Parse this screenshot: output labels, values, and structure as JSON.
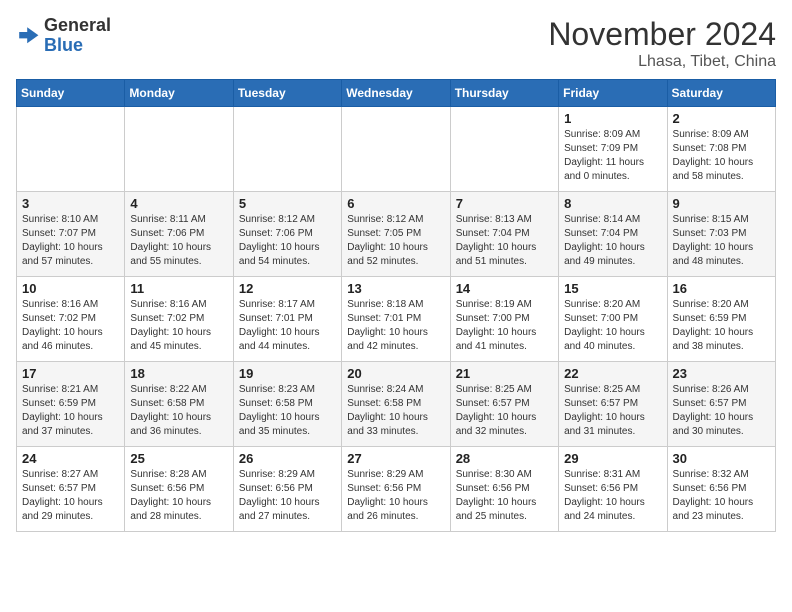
{
  "header": {
    "logo_general": "General",
    "logo_blue": "Blue",
    "month_title": "November 2024",
    "location": "Lhasa, Tibet, China"
  },
  "days_of_week": [
    "Sunday",
    "Monday",
    "Tuesday",
    "Wednesday",
    "Thursday",
    "Friday",
    "Saturday"
  ],
  "weeks": [
    [
      {
        "day": "",
        "info": ""
      },
      {
        "day": "",
        "info": ""
      },
      {
        "day": "",
        "info": ""
      },
      {
        "day": "",
        "info": ""
      },
      {
        "day": "",
        "info": ""
      },
      {
        "day": "1",
        "info": "Sunrise: 8:09 AM\nSunset: 7:09 PM\nDaylight: 11 hours\nand 0 minutes."
      },
      {
        "day": "2",
        "info": "Sunrise: 8:09 AM\nSunset: 7:08 PM\nDaylight: 10 hours\nand 58 minutes."
      }
    ],
    [
      {
        "day": "3",
        "info": "Sunrise: 8:10 AM\nSunset: 7:07 PM\nDaylight: 10 hours\nand 57 minutes."
      },
      {
        "day": "4",
        "info": "Sunrise: 8:11 AM\nSunset: 7:06 PM\nDaylight: 10 hours\nand 55 minutes."
      },
      {
        "day": "5",
        "info": "Sunrise: 8:12 AM\nSunset: 7:06 PM\nDaylight: 10 hours\nand 54 minutes."
      },
      {
        "day": "6",
        "info": "Sunrise: 8:12 AM\nSunset: 7:05 PM\nDaylight: 10 hours\nand 52 minutes."
      },
      {
        "day": "7",
        "info": "Sunrise: 8:13 AM\nSunset: 7:04 PM\nDaylight: 10 hours\nand 51 minutes."
      },
      {
        "day": "8",
        "info": "Sunrise: 8:14 AM\nSunset: 7:04 PM\nDaylight: 10 hours\nand 49 minutes."
      },
      {
        "day": "9",
        "info": "Sunrise: 8:15 AM\nSunset: 7:03 PM\nDaylight: 10 hours\nand 48 minutes."
      }
    ],
    [
      {
        "day": "10",
        "info": "Sunrise: 8:16 AM\nSunset: 7:02 PM\nDaylight: 10 hours\nand 46 minutes."
      },
      {
        "day": "11",
        "info": "Sunrise: 8:16 AM\nSunset: 7:02 PM\nDaylight: 10 hours\nand 45 minutes."
      },
      {
        "day": "12",
        "info": "Sunrise: 8:17 AM\nSunset: 7:01 PM\nDaylight: 10 hours\nand 44 minutes."
      },
      {
        "day": "13",
        "info": "Sunrise: 8:18 AM\nSunset: 7:01 PM\nDaylight: 10 hours\nand 42 minutes."
      },
      {
        "day": "14",
        "info": "Sunrise: 8:19 AM\nSunset: 7:00 PM\nDaylight: 10 hours\nand 41 minutes."
      },
      {
        "day": "15",
        "info": "Sunrise: 8:20 AM\nSunset: 7:00 PM\nDaylight: 10 hours\nand 40 minutes."
      },
      {
        "day": "16",
        "info": "Sunrise: 8:20 AM\nSunset: 6:59 PM\nDaylight: 10 hours\nand 38 minutes."
      }
    ],
    [
      {
        "day": "17",
        "info": "Sunrise: 8:21 AM\nSunset: 6:59 PM\nDaylight: 10 hours\nand 37 minutes."
      },
      {
        "day": "18",
        "info": "Sunrise: 8:22 AM\nSunset: 6:58 PM\nDaylight: 10 hours\nand 36 minutes."
      },
      {
        "day": "19",
        "info": "Sunrise: 8:23 AM\nSunset: 6:58 PM\nDaylight: 10 hours\nand 35 minutes."
      },
      {
        "day": "20",
        "info": "Sunrise: 8:24 AM\nSunset: 6:58 PM\nDaylight: 10 hours\nand 33 minutes."
      },
      {
        "day": "21",
        "info": "Sunrise: 8:25 AM\nSunset: 6:57 PM\nDaylight: 10 hours\nand 32 minutes."
      },
      {
        "day": "22",
        "info": "Sunrise: 8:25 AM\nSunset: 6:57 PM\nDaylight: 10 hours\nand 31 minutes."
      },
      {
        "day": "23",
        "info": "Sunrise: 8:26 AM\nSunset: 6:57 PM\nDaylight: 10 hours\nand 30 minutes."
      }
    ],
    [
      {
        "day": "24",
        "info": "Sunrise: 8:27 AM\nSunset: 6:57 PM\nDaylight: 10 hours\nand 29 minutes."
      },
      {
        "day": "25",
        "info": "Sunrise: 8:28 AM\nSunset: 6:56 PM\nDaylight: 10 hours\nand 28 minutes."
      },
      {
        "day": "26",
        "info": "Sunrise: 8:29 AM\nSunset: 6:56 PM\nDaylight: 10 hours\nand 27 minutes."
      },
      {
        "day": "27",
        "info": "Sunrise: 8:29 AM\nSunset: 6:56 PM\nDaylight: 10 hours\nand 26 minutes."
      },
      {
        "day": "28",
        "info": "Sunrise: 8:30 AM\nSunset: 6:56 PM\nDaylight: 10 hours\nand 25 minutes."
      },
      {
        "day": "29",
        "info": "Sunrise: 8:31 AM\nSunset: 6:56 PM\nDaylight: 10 hours\nand 24 minutes."
      },
      {
        "day": "30",
        "info": "Sunrise: 8:32 AM\nSunset: 6:56 PM\nDaylight: 10 hours\nand 23 minutes."
      }
    ]
  ]
}
